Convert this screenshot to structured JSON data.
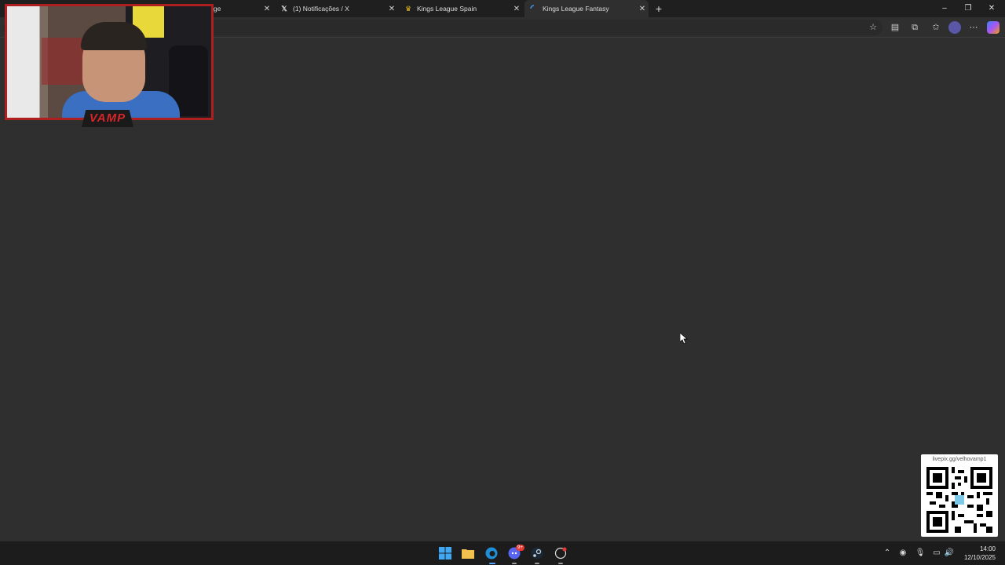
{
  "tabs": [
    {
      "label": "ews & Coverage",
      "favicon": "news-favicon",
      "active": false
    },
    {
      "label": "(1) Notificações / X",
      "favicon": "x-favicon",
      "active": false
    },
    {
      "label": "Kings League Spain",
      "favicon": "crown-favicon",
      "active": false
    },
    {
      "label": "Kings League Fantasy",
      "favicon": "loading-spinner",
      "active": true
    }
  ],
  "new_tab_label": "+",
  "window_controls": {
    "minimize": "–",
    "restore": "❐",
    "close": "✕"
  },
  "toolbar_icons": [
    "star-icon",
    "reading-list-icon",
    "extensions-icon",
    "favorites-icon",
    "profile-avatar",
    "more-icon",
    "copilot-icon"
  ],
  "webcam": {
    "overlay_logo": "VAMP"
  },
  "qr": {
    "url": "livepix.gg/velhovamp1"
  },
  "taskbar": {
    "apps": [
      "windows-start-icon",
      "file-explorer-icon",
      "edge-icon",
      "discord-icon",
      "steam-icon",
      "app-icon"
    ],
    "discord_badge": "9+"
  },
  "clock": {
    "time": "14:00",
    "date": "12/10/2025"
  },
  "colors": {
    "page_bg": "#2f2f2f",
    "tabstrip_bg": "#1f1f1f",
    "taskbar_bg": "#1c1c1c",
    "webcam_border": "#b01f1f"
  }
}
